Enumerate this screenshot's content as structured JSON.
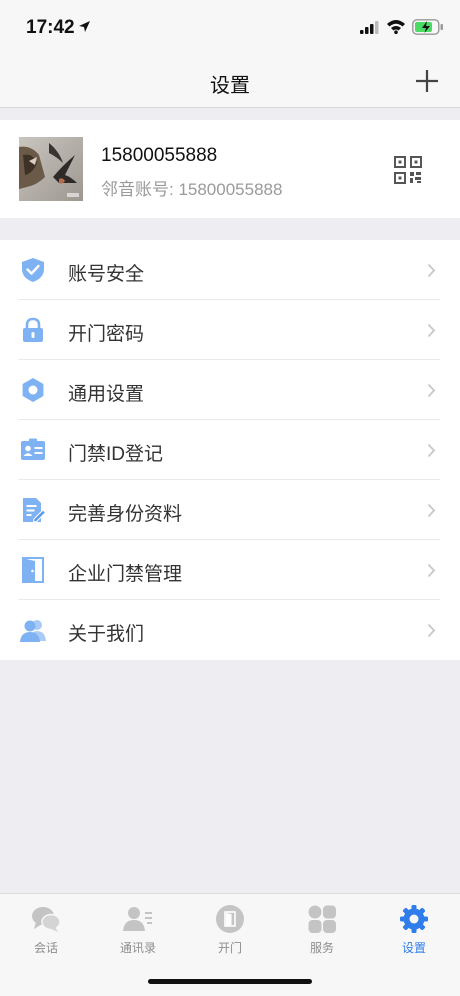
{
  "status_bar": {
    "time": "17:42"
  },
  "nav": {
    "title": "设置"
  },
  "profile": {
    "phone": "15800055888",
    "account_label": "邻音账号: 15800055888"
  },
  "menu": {
    "items": [
      {
        "label": "账号安全",
        "icon": "shield-check-icon"
      },
      {
        "label": "开门密码",
        "icon": "lock-icon"
      },
      {
        "label": "通用设置",
        "icon": "gear-icon"
      },
      {
        "label": "门禁ID登记",
        "icon": "id-card-icon"
      },
      {
        "label": "完善身份资料",
        "icon": "edit-document-icon"
      },
      {
        "label": "企业门禁管理",
        "icon": "door-icon"
      },
      {
        "label": "关于我们",
        "icon": "users-icon"
      }
    ]
  },
  "tabs": [
    {
      "label": "会话",
      "icon": "chat-bubbles-icon"
    },
    {
      "label": "通讯录",
      "icon": "contacts-icon"
    },
    {
      "label": "开门",
      "icon": "open-door-icon"
    },
    {
      "label": "服务",
      "icon": "grid-icon"
    },
    {
      "label": "设置",
      "icon": "gear-icon",
      "active": true
    }
  ],
  "colors": {
    "accent": "#2f7dea",
    "icon_blue": "#7fb2f2",
    "tab_inactive": "#c4c4c4",
    "background": "#eeedf2"
  }
}
